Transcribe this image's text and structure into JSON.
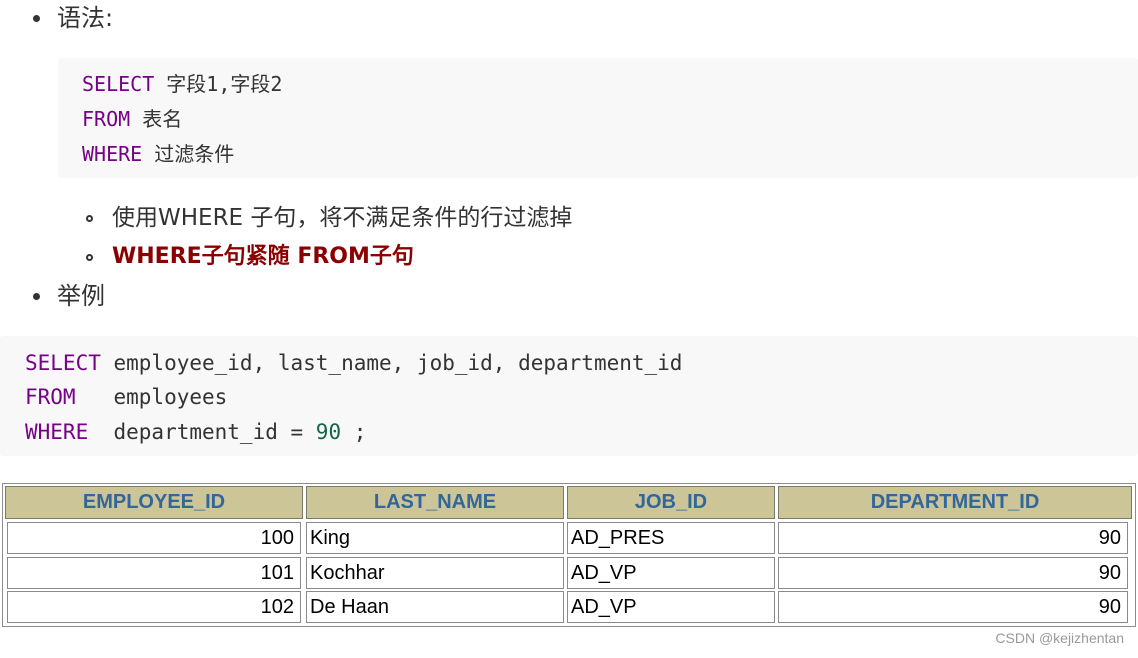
{
  "bullets": {
    "syntax_label": "语法:",
    "example_label": "举例"
  },
  "syntax_code": {
    "line1_kw": "SELECT",
    "line1_rest": " 字段1,字段2",
    "line2_kw": "FROM",
    "line2_rest": " 表名",
    "line3_kw": "WHERE",
    "line3_rest": " 过滤条件"
  },
  "sub_bullets": {
    "item1": "使用WHERE 子句，将不满足条件的行过滤掉",
    "item2": "WHERE子句紧随 FROM子句"
  },
  "example_code": {
    "line1_kw": "SELECT",
    "line1_rest": " employee_id, last_name, job_id, department_id",
    "line2_kw": "FROM",
    "line2_rest": "   employees",
    "line3_kw": "WHERE",
    "line3_rest_a": "  department_id = ",
    "line3_num": "90",
    "line3_rest_b": " ;"
  },
  "result_table": {
    "headers": [
      "EMPLOYEE_ID",
      "LAST_NAME",
      "JOB_ID",
      "DEPARTMENT_ID"
    ],
    "rows": [
      [
        "100",
        "King",
        "AD_PRES",
        "90"
      ],
      [
        "101",
        "Kochhar",
        "AD_VP",
        "90"
      ],
      [
        "102",
        "De Haan",
        "AD_VP",
        "90"
      ]
    ]
  },
  "watermark": "CSDN @kejizhentan",
  "colors": {
    "keyword": "#770088",
    "number": "#116644",
    "header_bg": "#cbc598",
    "header_text": "#336699",
    "emphasis": "#8b0000"
  }
}
